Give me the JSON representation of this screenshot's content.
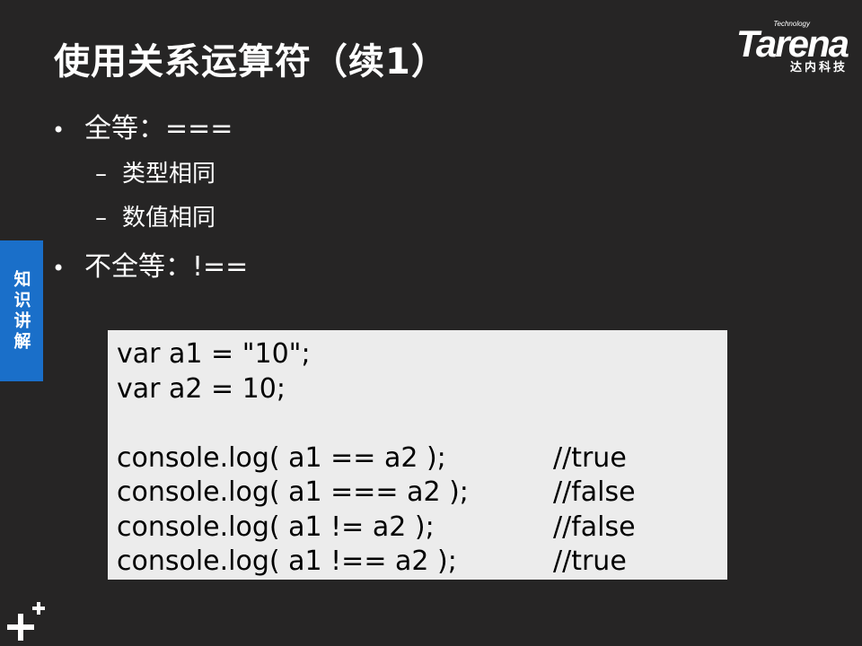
{
  "slide": {
    "title": "使用关系运算符（续1）",
    "side_tab": "知识讲解",
    "logo": {
      "small": "Technology",
      "word": "Tarena",
      "cn": "达内科技"
    },
    "bullets": [
      {
        "marker": "•",
        "text": "全等：==="
      },
      {
        "marker": "•",
        "text": "不全等：!=="
      }
    ],
    "sub_items": [
      {
        "marker": "–",
        "text": "类型相同"
      },
      {
        "marker": "–",
        "text": "数值相同"
      }
    ],
    "code": [
      {
        "code": "var a1 = \"10\";",
        "comment": ""
      },
      {
        "code": "var a2 = 10;",
        "comment": ""
      },
      {
        "code": "",
        "comment": ""
      },
      {
        "code": "console.log( a1 == a2 );",
        "comment": "//true"
      },
      {
        "code": "console.log( a1 === a2 );",
        "comment": "//false"
      },
      {
        "code": "console.log( a1 != a2 );",
        "comment": "//false"
      },
      {
        "code": "console.log( a1 !== a2 );",
        "comment": "//true"
      }
    ],
    "colors": {
      "background": "#262525",
      "side_tab": "#1a6fc9",
      "code_bg": "#ececec"
    },
    "icons": [
      "plus-plus-icon"
    ]
  }
}
